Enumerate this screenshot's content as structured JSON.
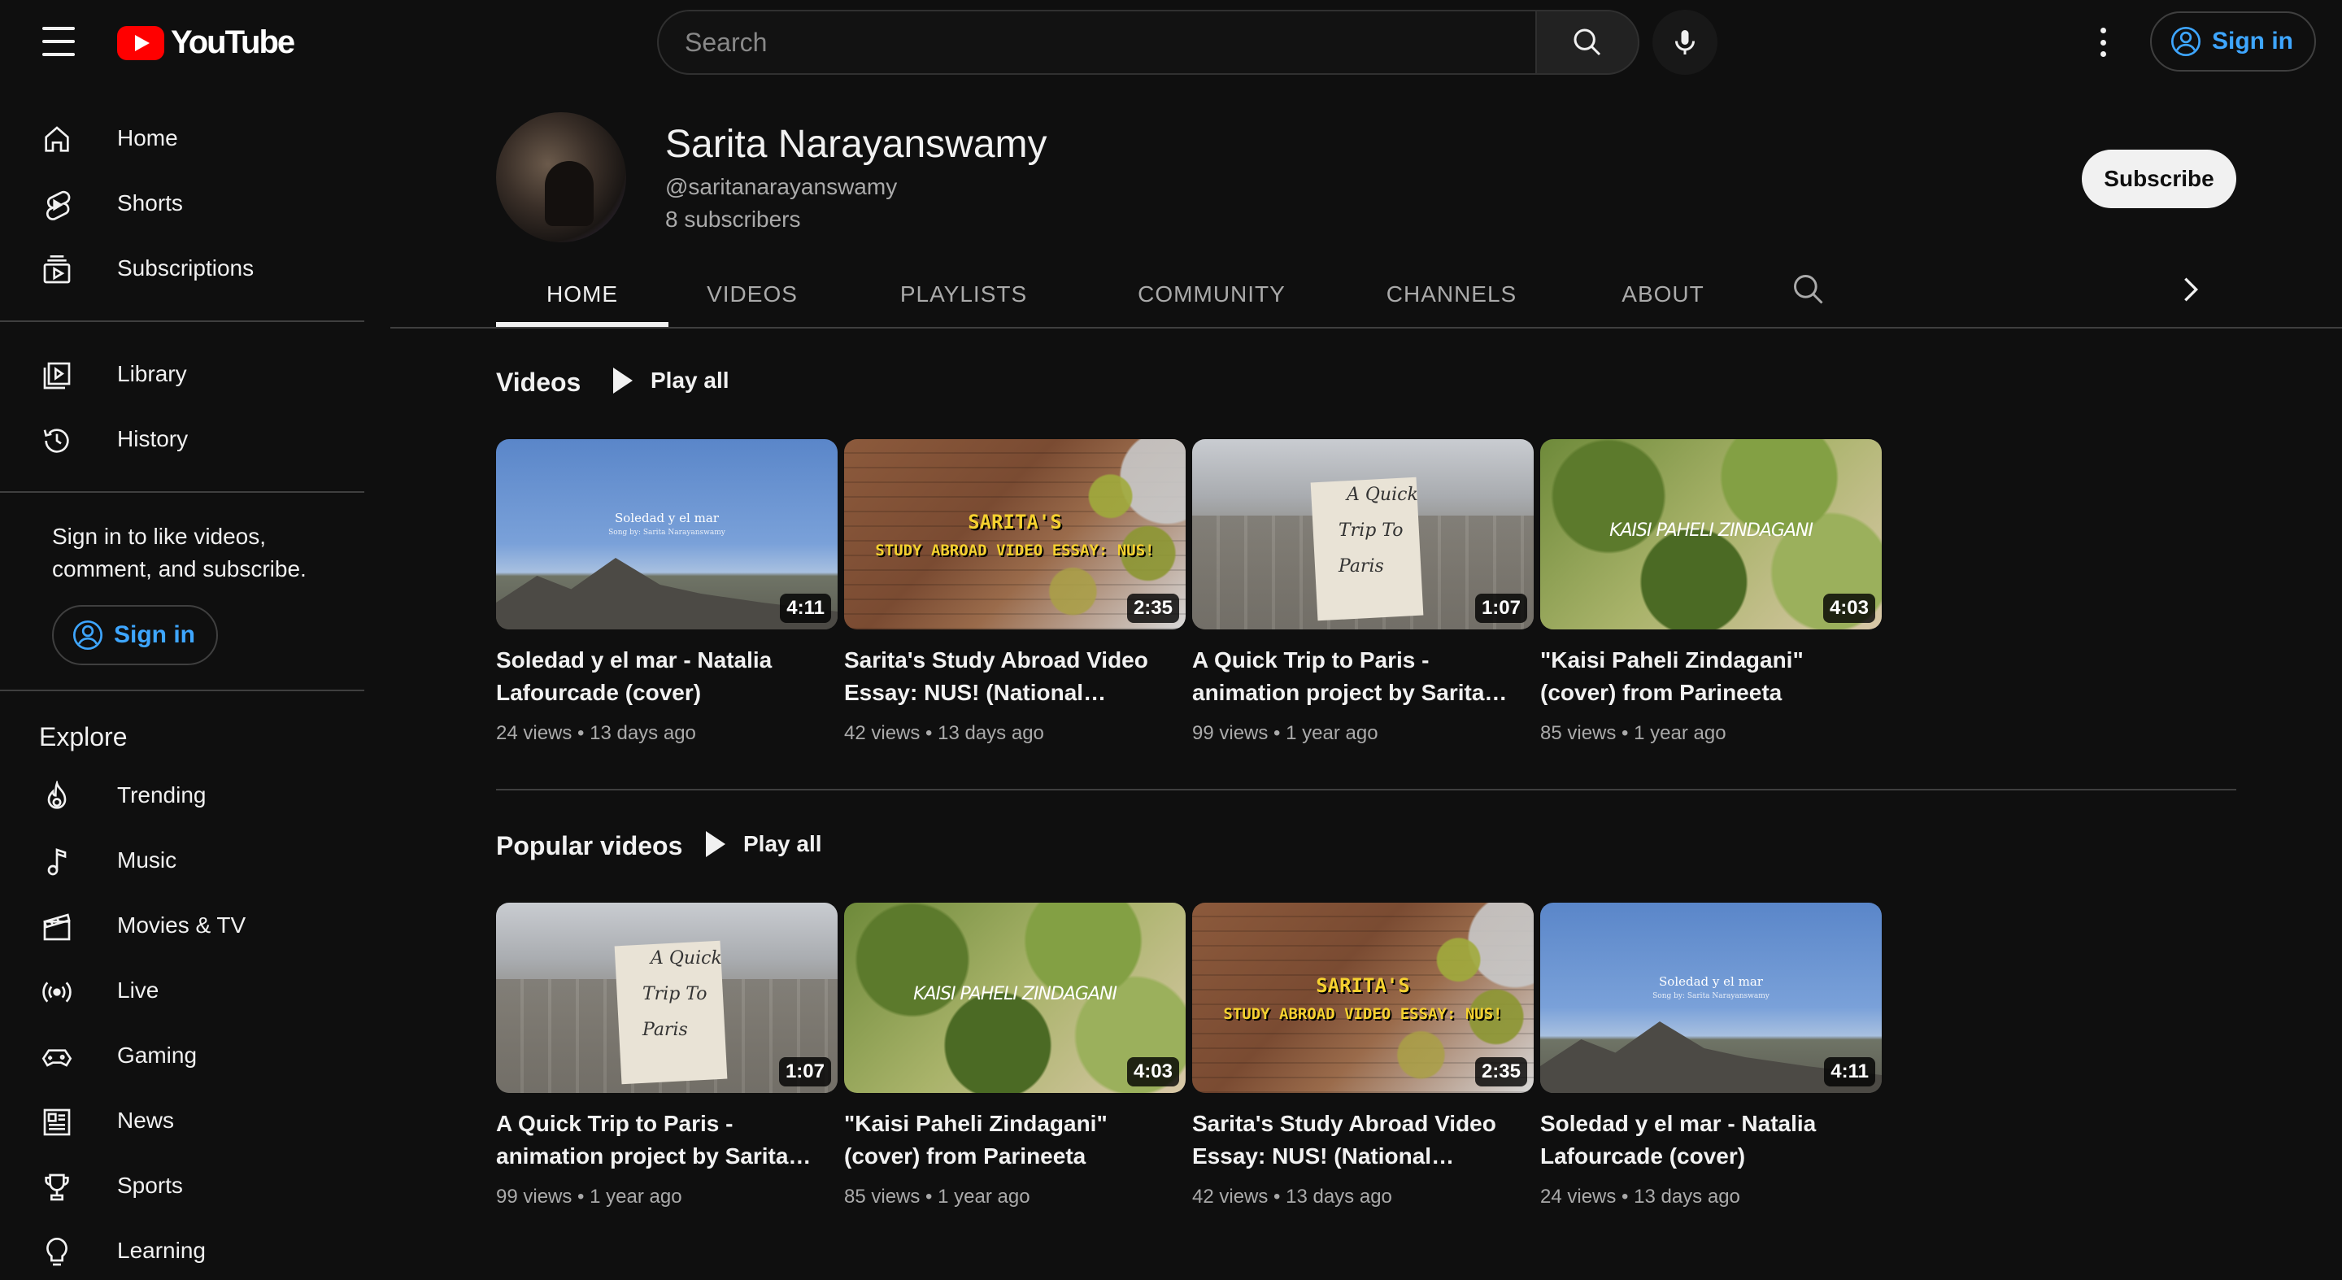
{
  "header": {
    "logo_text": "YouTube",
    "search_placeholder": "Search",
    "sign_in_label": "Sign in"
  },
  "sidebar": {
    "primary": [
      {
        "label": "Home",
        "icon": "home-icon"
      },
      {
        "label": "Shorts",
        "icon": "shorts-icon"
      },
      {
        "label": "Subscriptions",
        "icon": "subscriptions-icon"
      }
    ],
    "secondary": [
      {
        "label": "Library",
        "icon": "library-icon"
      },
      {
        "label": "History",
        "icon": "history-icon"
      }
    ],
    "signin_prompt": "Sign in to like videos, comment, and subscribe.",
    "sign_in_label": "Sign in",
    "explore_title": "Explore",
    "explore": [
      {
        "label": "Trending",
        "icon": "trending-icon"
      },
      {
        "label": "Music",
        "icon": "music-icon"
      },
      {
        "label": "Movies & TV",
        "icon": "movies-icon"
      },
      {
        "label": "Live",
        "icon": "live-icon"
      },
      {
        "label": "Gaming",
        "icon": "gaming-icon"
      },
      {
        "label": "News",
        "icon": "news-icon"
      },
      {
        "label": "Sports",
        "icon": "sports-icon"
      },
      {
        "label": "Learning",
        "icon": "learning-icon"
      }
    ]
  },
  "channel": {
    "name": "Sarita Narayanswamy",
    "handle": "@saritanarayanswamy",
    "subscribers": "8 subscribers",
    "subscribe_label": "Subscribe"
  },
  "tabs": [
    {
      "label": "HOME",
      "active": true
    },
    {
      "label": "VIDEOS",
      "active": false
    },
    {
      "label": "PLAYLISTS",
      "active": false
    },
    {
      "label": "COMMUNITY",
      "active": false
    },
    {
      "label": "CHANNELS",
      "active": false
    },
    {
      "label": "ABOUT",
      "active": false
    }
  ],
  "shelves": [
    {
      "title": "Videos",
      "play_all": "Play all",
      "videos": [
        {
          "title": "Soledad y el mar - Natalia Lafourcade (cover)",
          "duration": "4:11",
          "views": "24 views",
          "age": "13 days ago",
          "thumb": "soledad"
        },
        {
          "title": "Sarita's Study Abroad Video Essay: NUS! (National University of Singapore)",
          "duration": "2:35",
          "views": "42 views",
          "age": "13 days ago",
          "thumb": "study"
        },
        {
          "title": "A Quick Trip to Paris - animation project by Sarita Narayanswamy",
          "duration": "1:07",
          "views": "99 views",
          "age": "1 year ago",
          "thumb": "paris"
        },
        {
          "title": "\"Kaisi Paheli Zindagani\" (cover) from Parineeta",
          "duration": "4:03",
          "views": "85 views",
          "age": "1 year ago",
          "thumb": "kaisi"
        }
      ]
    },
    {
      "title": "Popular videos",
      "play_all": "Play all",
      "videos": [
        {
          "title": "A Quick Trip to Paris - animation project by Sarita Narayanswamy",
          "duration": "1:07",
          "views": "99 views",
          "age": "1 year ago",
          "thumb": "paris"
        },
        {
          "title": "\"Kaisi Paheli Zindagani\" (cover) from Parineeta",
          "duration": "4:03",
          "views": "85 views",
          "age": "1 year ago",
          "thumb": "kaisi"
        },
        {
          "title": "Sarita's Study Abroad Video Essay: NUS! (National University of Singapore)",
          "duration": "2:35",
          "views": "42 views",
          "age": "13 days ago",
          "thumb": "study"
        },
        {
          "title": "Soledad y el mar - Natalia Lafourcade (cover)",
          "duration": "4:11",
          "views": "24 views",
          "age": "13 days ago",
          "thumb": "soledad"
        }
      ]
    }
  ],
  "thumb_text": {
    "soledad_line1": "Soledad y el mar",
    "soledad_line2": "Song by: Sarita Narayanswamy",
    "study_line1": "SARITA'S",
    "study_line2": "STUDY ABROAD VIDEO ESSAY: NUS!",
    "paris_line1": "A Quick",
    "paris_line2": "Trip To",
    "paris_line3": "Paris",
    "kaisi_line1": "KAISI PAHELI ZINDAGANI"
  },
  "colors": {
    "background": "#0f0f0f",
    "accent_link": "#3ea6ff",
    "brand_red": "#ff0000"
  }
}
